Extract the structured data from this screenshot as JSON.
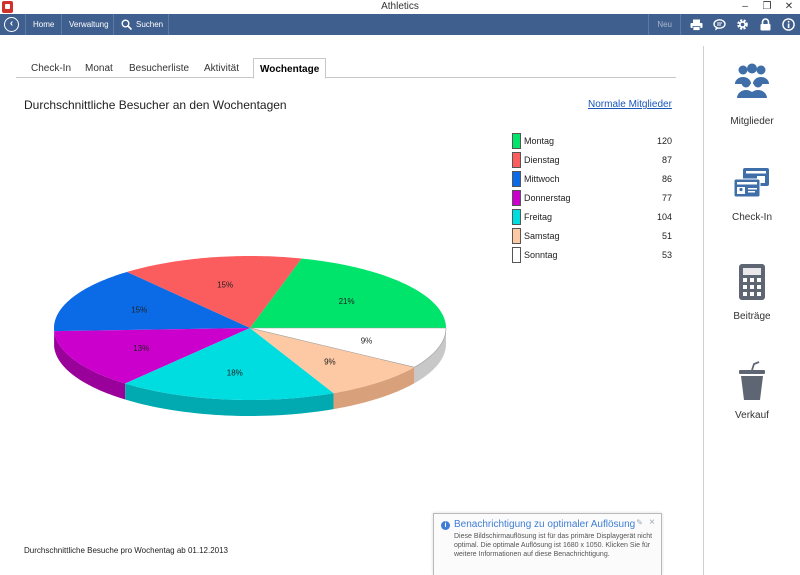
{
  "window": {
    "title": "Athletics",
    "buttons": [
      "–",
      "❐",
      "✕"
    ]
  },
  "toolbar": {
    "items": [
      "Home",
      "Verwaltung",
      "Suchen"
    ],
    "new_label": "Neu"
  },
  "tabs": [
    "Check-In",
    "Monat",
    "Besucherliste",
    "Aktivität",
    "Wochentage"
  ],
  "active_tab": "Wochentage",
  "page": {
    "title": "Durchschnittliche Besucher an den Wochentagen",
    "link": "Normale Mitglieder",
    "footnote": "Durchschnittliche Besuche pro Wochentag ab 01.12.2013"
  },
  "chart_data": {
    "type": "pie",
    "categories": [
      "Montag",
      "Dienstag",
      "Mittwoch",
      "Donnerstag",
      "Freitag",
      "Samstag",
      "Sonntag"
    ],
    "values": [
      120,
      87,
      86,
      77,
      104,
      51,
      53
    ],
    "slice_labels": [
      "21%",
      "15%",
      "15%",
      "13%",
      "18%",
      "9%",
      "9%"
    ],
    "colors": [
      "#00e46b",
      "#fb5c5e",
      "#0b6be6",
      "#cc00cc",
      "#00dde0",
      "#fcc9a4",
      "#ffffff"
    ],
    "side_colors": [
      "#0fae45",
      "#c9232a",
      "#0546c2",
      "#9a009a",
      "#00aab0",
      "#d8a17b",
      "#c8c8c8"
    ],
    "legend_position": "right"
  },
  "sidebar": {
    "items": [
      {
        "label": "Mitglieder",
        "icon": "members-icon"
      },
      {
        "label": "Check-In",
        "icon": "checkin-cards-icon"
      },
      {
        "label": "Beiträge",
        "icon": "calculator-icon"
      },
      {
        "label": "Verkauf",
        "icon": "cup-icon"
      }
    ]
  },
  "notification": {
    "title": "Benachrichtigung zu optimaler Auflösung",
    "body": "Diese Bildschirmauflösung ist für das primäre Displaygerät nicht optimal. Die optimale Auflösung ist 1680 x 1050. Klicken Sie für weitere Informationen auf diese Benachrichtigung."
  },
  "colors": {
    "toolbar": "#3f5f8e",
    "link": "#1a56b8",
    "accent": "#3f7ed6",
    "sidebar_icon": "#3f6ea8"
  }
}
